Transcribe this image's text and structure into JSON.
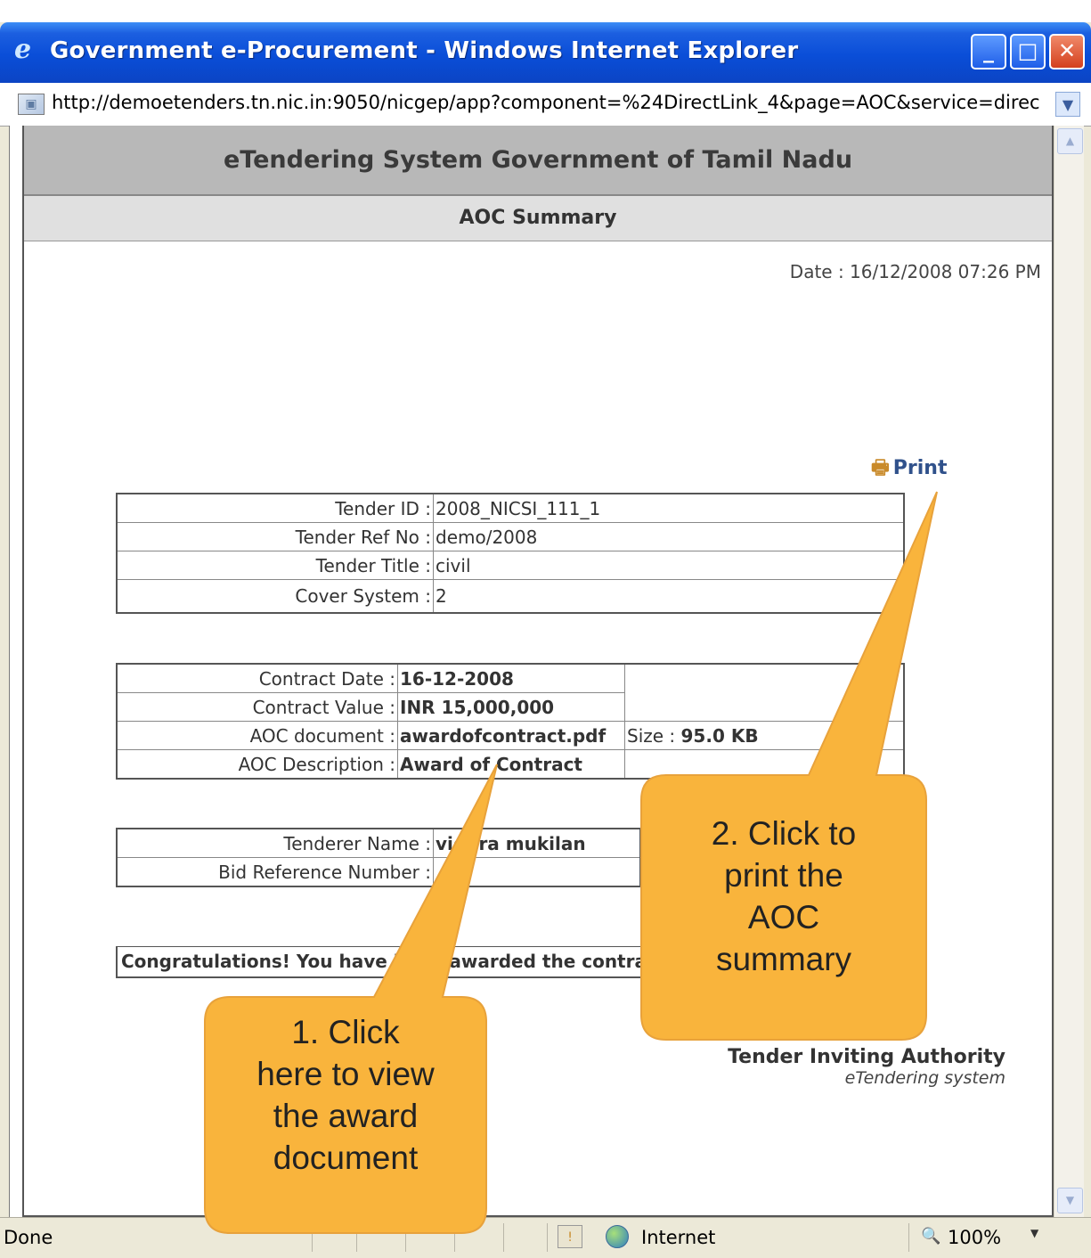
{
  "window": {
    "title": "Government e-Procurement - Windows Internet Explorer",
    "address": "http://demoetenders.tn.nic.in:9050/nicgep/app?component=%24DirectLink_4&page=AOC&service=direc"
  },
  "page": {
    "header": "eTendering System Government of Tamil Nadu",
    "subheader": "AOC Summary",
    "date": "Date : 16/12/2008 07:26 PM",
    "print_label": "Print"
  },
  "tender_table": [
    {
      "label": "Tender ID :",
      "value": "2008_NICSI_111_1"
    },
    {
      "label": "Tender Ref No :",
      "value": "demo/2008"
    },
    {
      "label": "Tender Title :",
      "value": "civil"
    },
    {
      "label": "Cover System :",
      "value": "2"
    }
  ],
  "contract_table": {
    "contract_date_label": "Contract Date :",
    "contract_date": "16-12-2008",
    "contract_value_label": "Contract Value :",
    "contract_value": "INR 15,000,000",
    "aoc_document_label": "AOC document :",
    "aoc_document": "awardofcontract.pdf",
    "size_label": "Size :",
    "size_value": "95.0 KB",
    "aoc_description_label": "AOC Description :",
    "aoc_description": "Award of Contract"
  },
  "tenderer_table": {
    "name_label": "Tenderer Name :",
    "name": "vidhra mukilan",
    "bid_ref_label": "Bid Reference Number :",
    "bid_ref": ""
  },
  "congrats": "Congratulations! You have been awarded the contract",
  "authority": {
    "line1": "Tender Inviting Authority",
    "line2": "eTendering system"
  },
  "statusbar": {
    "status": "Done",
    "zone": "Internet",
    "zoom": "100%"
  },
  "callouts": {
    "one": [
      "1. Click",
      "here to view",
      "the award",
      "document"
    ],
    "two": [
      "2. Click  to",
      "print the",
      "AOC",
      "summary"
    ]
  },
  "colors": {
    "titlebar": "#0a4ed8",
    "callout_fill": "#f9b43c",
    "callout_border": "#e8a23b",
    "link": "#33609c"
  }
}
